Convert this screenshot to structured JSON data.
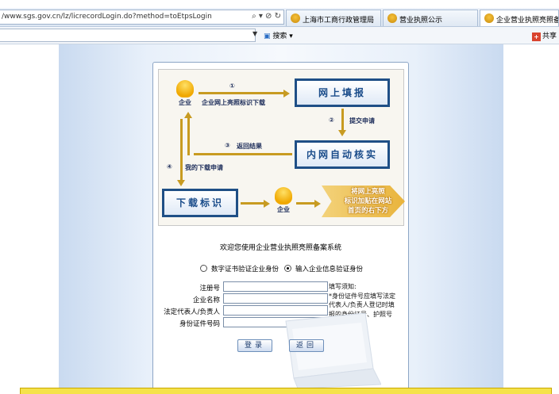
{
  "browser": {
    "url": "/www.sgs.gov.cn/lz/licrecordLogin.do?method=toEtpsLogin",
    "address_icons": "⌕ ▾ ⊘ ↻",
    "tabs": [
      {
        "label": "上海市工商行政管理局"
      },
      {
        "label": "营业执照公示"
      },
      {
        "label": "企业营业执照亮照备案"
      }
    ],
    "search_label": "搜索",
    "share_label": "共享"
  },
  "diagram": {
    "enterprise_label": "企业",
    "box_online_fill": "网上填报",
    "box_intranet_verify": "内网自动核实",
    "box_download": "下载标识",
    "step1_num": "①",
    "step1_text": "企业网上亮照标识下载",
    "step2_num": "②",
    "step2_text": "提交申请",
    "step3_num": "③",
    "step3_text": "返回结果",
    "step4_num": "④",
    "step4_text": "我的下载申请",
    "slogan_line1": "将网上亮照",
    "slogan_line2": "标识加贴在网站",
    "slogan_line3": "首页的右下方"
  },
  "form": {
    "welcome": "欢迎您使用企业营业执照亮照备案系统",
    "radio_cert": "数字证书验证企业身份",
    "radio_info": "输入企业信息验证身份",
    "selected": "info",
    "label_reg_no": "注册号",
    "label_name": "企业名称",
    "label_legal_rep": "法定代表人/负责人",
    "label_id_no": "身份证件号码",
    "value_reg_no": "",
    "value_name": "",
    "value_legal_rep": "",
    "value_id_no": "",
    "notes_title": "填写须知:",
    "notes_body": "*身份证件号应填写法定代表人/负责人登记时填报的身份证号、护照号等。",
    "login_button": "登录",
    "back_button": "返回"
  },
  "colors": {
    "box_border": "#1f4f86",
    "arrow": "#c89b21",
    "bottom_bar": "#f5e24a"
  }
}
